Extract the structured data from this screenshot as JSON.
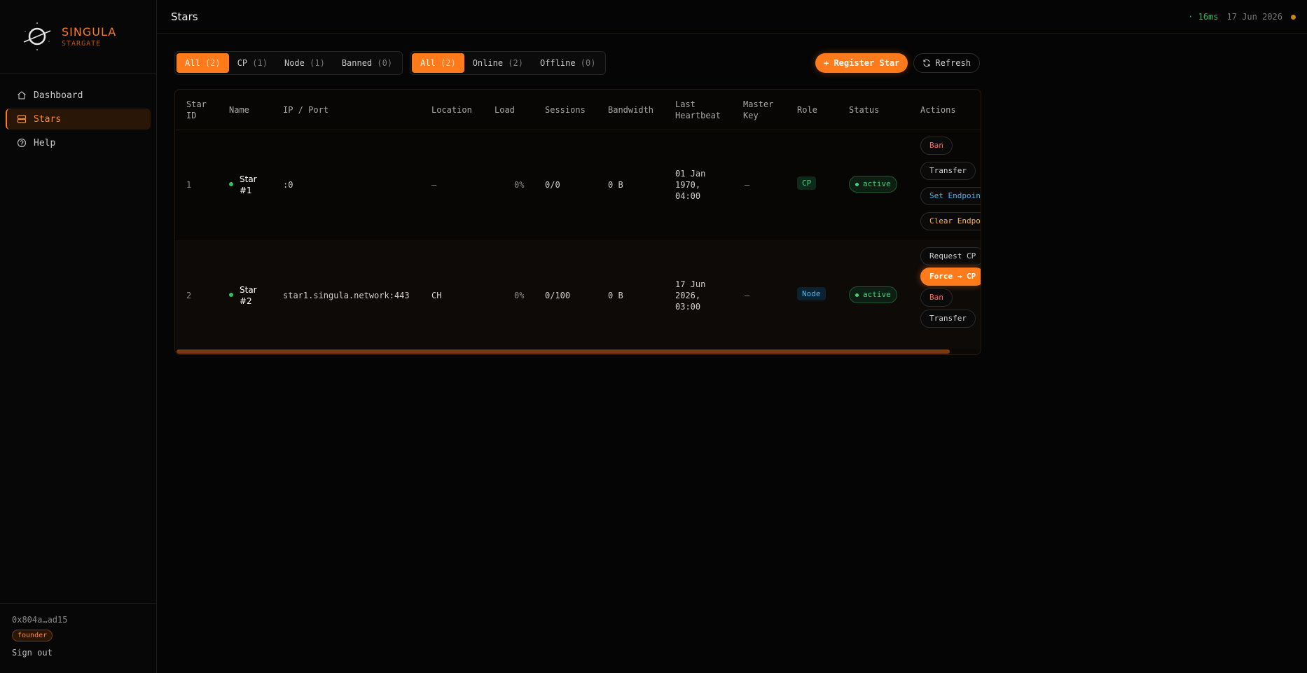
{
  "brand": {
    "name": "SINGULA",
    "sub": "STARGATE"
  },
  "sidebar": {
    "items": [
      {
        "label": "Dashboard",
        "icon": "home-icon"
      },
      {
        "label": "Stars",
        "icon": "server-icon"
      },
      {
        "label": "Help",
        "icon": "help-circle-icon"
      }
    ],
    "wallet": "0x804a…ad15",
    "badge": "founder",
    "signout": "Sign out"
  },
  "header": {
    "title": "Stars",
    "latency": "· 16ms",
    "date": "17 Jun 2026"
  },
  "filters": {
    "role": [
      {
        "label": "All",
        "count": "(2)"
      },
      {
        "label": "CP",
        "count": "(1)"
      },
      {
        "label": "Node",
        "count": "(1)"
      },
      {
        "label": "Banned",
        "count": "(0)"
      }
    ],
    "status": [
      {
        "label": "All",
        "count": "(2)"
      },
      {
        "label": "Online",
        "count": "(2)"
      },
      {
        "label": "Offline",
        "count": "(0)"
      }
    ]
  },
  "actions": {
    "register": "+ Register Star",
    "refresh": "Refresh"
  },
  "table": {
    "headers": {
      "star_id": [
        "Star",
        "ID"
      ],
      "name": "Name",
      "ip": "IP / Port",
      "location": "Location",
      "load": "Load",
      "sessions": "Sessions",
      "bandwidth": "Bandwidth",
      "heartbeat": [
        "Last",
        "Heartbeat"
      ],
      "master": [
        "Master",
        "Key"
      ],
      "role": "Role",
      "status": "Status",
      "actions": "Actions"
    },
    "rows": [
      {
        "id": "1",
        "name": [
          "Star",
          "#1"
        ],
        "ip": ":0",
        "location": "—",
        "load": "0%",
        "sessions": "0/0",
        "bandwidth": "0 B",
        "heartbeat": [
          "01 Jan",
          "1970,",
          "04:00"
        ],
        "master": "—",
        "role": "CP",
        "status": "active",
        "actions": [
          "Ban",
          "Transfer",
          "Set Endpoint",
          "Clear Endpoint"
        ]
      },
      {
        "id": "2",
        "name": [
          "Star",
          "#2"
        ],
        "ip": "star1.singula.network:443",
        "location": "CH",
        "load": "0%",
        "sessions": "0/100",
        "bandwidth": "0 B",
        "heartbeat": [
          "17 Jun",
          "2026,",
          "03:00"
        ],
        "master": "—",
        "role": "Node",
        "status": "active",
        "actions": [
          "Request CP",
          "Force → CP",
          "Ban",
          "Transfer"
        ]
      }
    ]
  }
}
